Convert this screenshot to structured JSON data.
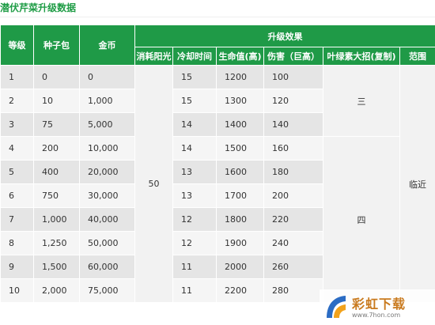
{
  "page": {
    "title": "潜伏芹菜升级数据"
  },
  "table": {
    "headers": {
      "level": "等级",
      "seed_pack": "种子包",
      "coins": "金币",
      "upgrade_effect": "升级效果",
      "sun_cost": "消耗阳光",
      "cooldown": "冷却时间",
      "health": "生命值(高)",
      "damage": "伤害（巨高）",
      "chlorophyll_move": "叶绿素大招(复制)",
      "range": "范围"
    },
    "sun_cost_value": "50",
    "chlorophyll_groups": [
      "三",
      "四"
    ],
    "range_value": "临近",
    "rows": [
      {
        "level": "1",
        "seed_pack": "0",
        "coins": "0",
        "cooldown": "15",
        "health": "1200",
        "damage": "100"
      },
      {
        "level": "2",
        "seed_pack": "10",
        "coins": "1,000",
        "cooldown": "15",
        "health": "1300",
        "damage": "120"
      },
      {
        "level": "3",
        "seed_pack": "75",
        "coins": "5,000",
        "cooldown": "14",
        "health": "1400",
        "damage": "140"
      },
      {
        "level": "4",
        "seed_pack": "200",
        "coins": "10,000",
        "cooldown": "14",
        "health": "1500",
        "damage": "160"
      },
      {
        "level": "5",
        "seed_pack": "400",
        "coins": "20,000",
        "cooldown": "13",
        "health": "1600",
        "damage": "180"
      },
      {
        "level": "6",
        "seed_pack": "750",
        "coins": "30,000",
        "cooldown": "13",
        "health": "1700",
        "damage": "200"
      },
      {
        "level": "7",
        "seed_pack": "1,000",
        "coins": "40,000",
        "cooldown": "12",
        "health": "1800",
        "damage": "220"
      },
      {
        "level": "8",
        "seed_pack": "1,250",
        "coins": "50,000",
        "cooldown": "12",
        "health": "1900",
        "damage": "240"
      },
      {
        "level": "9",
        "seed_pack": "1,500",
        "coins": "60,000",
        "cooldown": "11",
        "health": "2000",
        "damage": "260"
      },
      {
        "level": "10",
        "seed_pack": "2,000",
        "coins": "75,000",
        "cooldown": "11",
        "health": "2200",
        "damage": "280"
      }
    ]
  },
  "watermark": {
    "brand": "彩虹下载",
    "url": "www.7hon.com",
    "logo_icon": "rainbow-logo-icon",
    "logo_colors": [
      "#2b6cc4",
      "#f2a21b"
    ]
  }
}
